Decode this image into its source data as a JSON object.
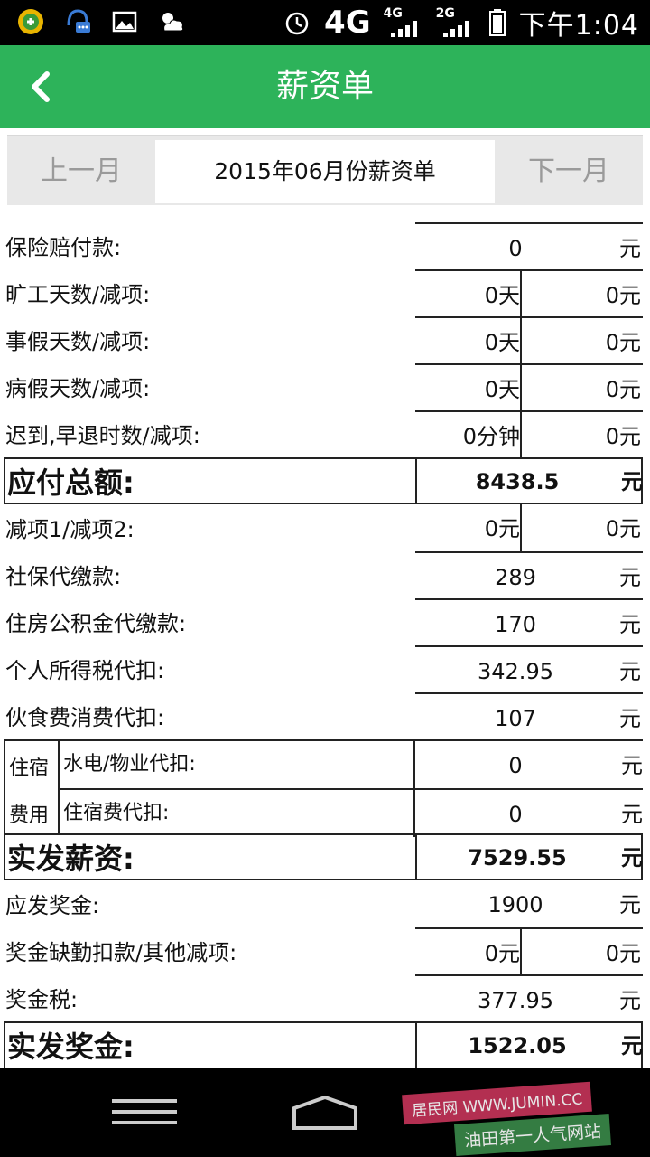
{
  "status_bar": {
    "time": "下午1:04",
    "network_primary": "4G",
    "sim1_label": "4G",
    "sim2_label": "2G",
    "colors": {
      "background": "#000000"
    },
    "icons": [
      "app-icon",
      "chat-notification-icon",
      "image-icon",
      "weather-icon",
      "alarm-icon",
      "battery-icon"
    ]
  },
  "header": {
    "title": "薪资单",
    "back_icon": "back-arrow-icon",
    "colors": {
      "accent": "#2db35a"
    }
  },
  "month_bar": {
    "prev_label": "上一月",
    "current_label": "2015年06月份薪资单",
    "next_label": "下一月"
  },
  "salary": {
    "insurance_payout": {
      "label": "保险赔付款:",
      "value": "0",
      "unit": "元"
    },
    "absence": {
      "label": "旷工天数/减项:",
      "days": "0天",
      "deduction": "0元"
    },
    "personal_leave": {
      "label": "事假天数/减项:",
      "days": "0天",
      "deduction": "0元"
    },
    "sick_leave": {
      "label": "病假天数/减项:",
      "days": "0天",
      "deduction": "0元"
    },
    "late_early": {
      "label": "迟到,早退时数/减项:",
      "time": "0分钟",
      "deduction": "0元"
    },
    "gross_total": {
      "label": "应付总额:",
      "value": "8438.5",
      "unit": "元"
    },
    "deductions_1_2": {
      "label": "减项1/减项2:",
      "d1": "0元",
      "d2": "0元"
    },
    "social_security": {
      "label": "社保代缴款:",
      "value": "289",
      "unit": "元"
    },
    "housing_fund": {
      "label": "住房公积金代缴款:",
      "value": "170",
      "unit": "元"
    },
    "income_tax": {
      "label": "个人所得税代扣:",
      "value": "342.95",
      "unit": "元"
    },
    "meals": {
      "label": "伙食费消费代扣:",
      "value": "107",
      "unit": "元"
    },
    "lodging": {
      "group_line1": "住宿",
      "group_line2": "费用",
      "utilities": {
        "label": "水电/物业代扣:",
        "value": "0",
        "unit": "元"
      },
      "rent": {
        "label": "住宿费代扣:",
        "value": "0",
        "unit": "元"
      }
    },
    "net_salary": {
      "label": "实发薪资:",
      "value": "7529.55",
      "unit": "元"
    },
    "bonus_due": {
      "label": "应发奖金:",
      "value": "1900",
      "unit": "元"
    },
    "bonus_deductions": {
      "label": "奖金缺勤扣款/其他减项:",
      "d1": "0元",
      "d2": "0元"
    },
    "bonus_tax": {
      "label": "奖金税:",
      "value": "377.95",
      "unit": "元"
    },
    "net_bonus": {
      "label": "实发奖金:",
      "value": "1522.05",
      "unit": "元"
    }
  },
  "nav_bar": {
    "watermark_line1": "居民网 WWW.JUMIN.CC",
    "watermark_line2": "油田第一人气网站"
  }
}
